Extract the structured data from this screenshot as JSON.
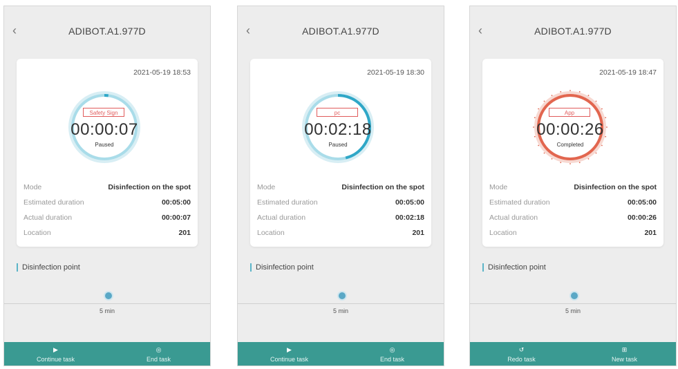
{
  "colors": {
    "accent": "#3a9a92",
    "ring_teal": "#2fa7c7",
    "ring_red": "#e2664f",
    "tag_red": "#e05a5a"
  },
  "screens": [
    {
      "title": "ADIBOT.A1.977D",
      "back_icon": "chevron-left-icon",
      "datetime": "2021-05-19 18:53",
      "source_tag": "Safety Sign",
      "elapsed": "00:00:07",
      "state": "Paused",
      "progress": 0.02,
      "ring_color": "teal",
      "rows": [
        {
          "label": "Mode",
          "value": "Disinfection on the spot"
        },
        {
          "label": "Estimated duration",
          "value": "00:05:00"
        },
        {
          "label": "Actual duration",
          "value": "00:00:07"
        },
        {
          "label": "Location",
          "value": "201"
        }
      ],
      "section_title": "Disinfection point",
      "point_duration": "5 min",
      "actions": [
        {
          "label": "Continue task",
          "icon": "play-icon"
        },
        {
          "label": "End task",
          "icon": "stop-circle-icon"
        }
      ]
    },
    {
      "title": "ADIBOT.A1.977D",
      "back_icon": "chevron-left-icon",
      "datetime": "2021-05-19 18:30",
      "source_tag": "pc",
      "elapsed": "00:02:18",
      "state": "Paused",
      "progress": 0.46,
      "ring_color": "teal",
      "rows": [
        {
          "label": "Mode",
          "value": "Disinfection on the spot"
        },
        {
          "label": "Estimated duration",
          "value": "00:05:00"
        },
        {
          "label": "Actual duration",
          "value": "00:02:18"
        },
        {
          "label": "Location",
          "value": "201"
        }
      ],
      "section_title": "Disinfection point",
      "point_duration": "5 min",
      "actions": [
        {
          "label": "Continue task",
          "icon": "play-icon"
        },
        {
          "label": "End task",
          "icon": "stop-circle-icon"
        }
      ]
    },
    {
      "title": "ADIBOT.A1.977D",
      "back_icon": "chevron-left-icon",
      "datetime": "2021-05-19 18:47",
      "source_tag": "App",
      "elapsed": "00:00:26",
      "state": "Completed",
      "progress": 1,
      "ring_color": "red",
      "rows": [
        {
          "label": "Mode",
          "value": "Disinfection on the spot"
        },
        {
          "label": "Estimated duration",
          "value": "00:05:00"
        },
        {
          "label": "Actual duration",
          "value": "00:00:26"
        },
        {
          "label": "Location",
          "value": "201"
        }
      ],
      "section_title": "Disinfection point",
      "point_duration": "5 min",
      "actions": [
        {
          "label": "Redo task",
          "icon": "redo-icon"
        },
        {
          "label": "New task",
          "icon": "new-task-icon"
        }
      ]
    }
  ]
}
